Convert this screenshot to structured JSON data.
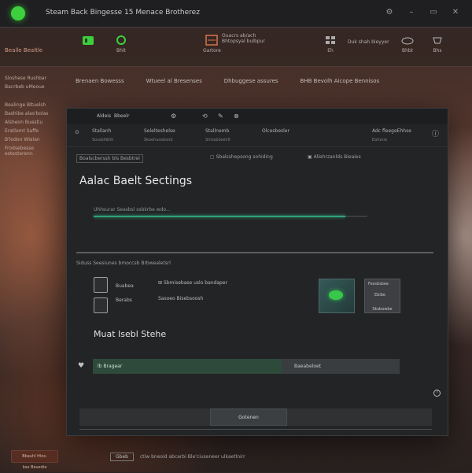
{
  "window": {
    "title": "Steam Back Bingesse 15 Menace Brotherez"
  },
  "top_controls": [
    "⚙",
    "–",
    "▭",
    "✕"
  ],
  "toolbar": [
    {
      "label": "",
      "icon": "library-icon",
      "color": "#3ecf3e"
    },
    {
      "label": "Bhlt",
      "icon": "refresh-icon",
      "color": "#3ecf3e"
    },
    {
      "label": "Gartore",
      "icon": "store-icon",
      "color": "#d9744e",
      "side": "Ouacrs ab/ach\nBhtopsyal bulbpur"
    },
    {
      "label": "Eh",
      "icon": "grid-icon",
      "color": "#b0b0b0",
      "side": "Duk shah bleyyer"
    },
    {
      "label": "Bhbt",
      "icon": "cloud-icon",
      "color": "#b0b0b0"
    },
    {
      "label": "Bhs",
      "icon": "settings-icon",
      "color": "#b0b0b0"
    }
  ],
  "nav": [
    "Brenaen Bowesss",
    "Wtueel al Bresenses",
    "Dhbuggese assures",
    "BHB Bevolh Aicope Bennisos"
  ],
  "left_panel": {
    "title": "Bealle Bealtle",
    "items": [
      "Sloshese Rushbar",
      "Bacrbeb uMeoue",
      "Bealinge Bltuelsh",
      "Bashibe alas'bolas",
      "Alsheon Buestiu",
      "Eratlemt Saffe",
      "B'lodon Wlalan",
      "Frodsebesse estesterenn"
    ],
    "badge": "Bbauhl  Hlos-\nbas Beuedie"
  },
  "modal": {
    "header_tabs": [
      "Aldeis",
      "Bbeelr"
    ],
    "header_icons": [
      "⚙",
      "⟲",
      "✎",
      "⊗"
    ],
    "columns": [
      {
        "label": "Stallanh",
        "sub": "Sossbhlbth"
      },
      {
        "label": "Selelteshelse",
        "sub": "Skoehuosbonb"
      },
      {
        "label": "Stallnemb",
        "sub": "Shlosbbsehlt"
      },
      {
        "label": "Olcesbesler",
        "sub": ""
      },
      {
        "label": "Adc fleegeEhhse",
        "sub": "Eafunia"
      }
    ],
    "tabs": {
      "first": "Boalscberssh bls Besbtrel",
      "second": "Sbalsshepsong sohiding",
      "third": "Allehrzanlds Bieaies"
    },
    "title": "Aalac Baelt Sectings",
    "progress": {
      "label": "Uhhsurar Seasbsl ssbkrbe wdo...",
      "value": 0.92
    },
    "section_label": "Siduss Seesiunes bmoccsb Brbwealetsrl",
    "options": [
      {
        "label": "Buabea",
        "icon": "mic-icon"
      },
      {
        "label": "Berabs",
        "icon": "speaker-icon"
      }
    ],
    "option_text": [
      "Sbmisebase uslo bandaper",
      "Sasoeo Bisebsoosh"
    ],
    "thumb_b": {
      "l1": "Fessbsbee",
      "l2": "Ebibe",
      "l3": "Sksbowbe"
    },
    "sub_title": "Muat Isebl Stehe",
    "field_left": "lb Bragear",
    "field_right": "Baeabeloet",
    "footer_button": "Gotenen"
  },
  "bottom_bar": {
    "button": "Gbeb",
    "text": "ctiw  bneoid abcarbi Ble'ciuseneer ulkaetlnirr"
  }
}
